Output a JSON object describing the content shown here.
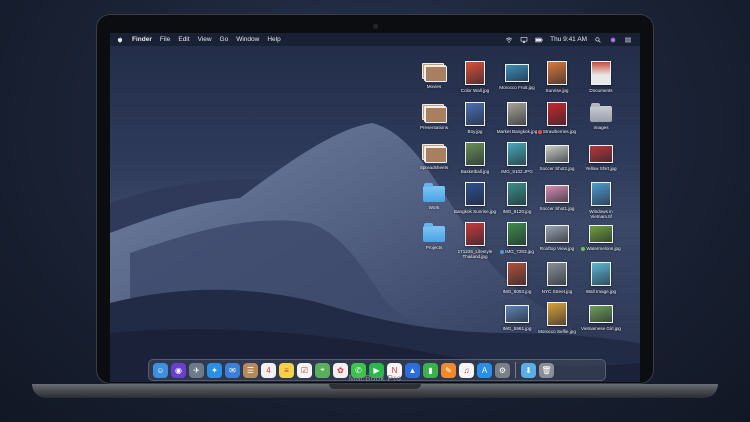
{
  "device": {
    "label": "MacBook Pro"
  },
  "menubar": {
    "items": [
      "Finder",
      "File",
      "Edit",
      "View",
      "Go",
      "Window",
      "Help"
    ],
    "clock": "Thu 9:41 AM",
    "icons": [
      "apple-icon",
      "wifi-icon",
      "airplay-icon",
      "battery-icon",
      "spotlight-icon",
      "siri-icon",
      "control-center-icon"
    ]
  },
  "desktop": {
    "items": [
      {
        "label": "Movies",
        "kind": "stack"
      },
      {
        "label": "Color Wall.jpg",
        "kind": "photo",
        "color": "#d9503a"
      },
      {
        "label": "Morocco Fruit.jpg",
        "kind": "photo-wide",
        "color": "#3b8fbf"
      },
      {
        "label": "Sunrise.jpg",
        "kind": "photo",
        "color": "#d97a3a"
      },
      {
        "label": "Documents",
        "kind": "doc"
      },
      {
        "label": "Presentations",
        "kind": "stack"
      },
      {
        "label": "Boy.jpg",
        "kind": "photo",
        "color": "#4b6fb5"
      },
      {
        "label": "Market Bangkok.jpg",
        "kind": "photo",
        "color": "#a8a39a"
      },
      {
        "label": "Strawberries.jpg",
        "kind": "photo",
        "color": "#c9282d",
        "tag": "#e84c3d"
      },
      {
        "label": "Images",
        "kind": "folder-gray"
      },
      {
        "label": "Spreadsheets",
        "kind": "stack"
      },
      {
        "label": "Basketball.jpg",
        "kind": "photo",
        "color": "#6a8f57"
      },
      {
        "label": "IMG_9102.JPG",
        "kind": "photo",
        "color": "#48a8b8"
      },
      {
        "label": "Soccer Shot2.jpg",
        "kind": "photo-wide",
        "color": "#c8cdc3"
      },
      {
        "label": "Yellow Shirt.jpg",
        "kind": "photo-wide",
        "color": "#b8363a"
      },
      {
        "label": "Work",
        "kind": "folder"
      },
      {
        "label": "Bangkok Sunrise.jpg",
        "kind": "photo",
        "color": "#2e4f8f"
      },
      {
        "label": "IMG_8120.jpg",
        "kind": "photo",
        "color": "#3a8f88"
      },
      {
        "label": "Soccer Shot1.jpg",
        "kind": "photo-wide",
        "color": "#d58fb0"
      },
      {
        "label": "Windows in Vietnam.tif",
        "kind": "photo",
        "color": "#4f9bd1"
      },
      {
        "label": "Projects",
        "kind": "folder"
      },
      {
        "label": "171225_Lifestyle Thailand.jpg",
        "kind": "photo",
        "color": "#c43a3a"
      },
      {
        "label": "IMG_7283.jpg",
        "kind": "photo",
        "color": "#3f8c4a",
        "tag": "#4a9be6"
      },
      {
        "label": "Rooftop View.jpg",
        "kind": "photo-wide",
        "color": "#9aa3ad"
      },
      {
        "label": "Watermelons.jpg",
        "kind": "photo-wide",
        "color": "#6fa03c",
        "tag": "#62c34a"
      },
      {
        "label": "IMG_6093.jpg",
        "kind": "photo",
        "color": "#b0503a"
      },
      {
        "label": "NYC Street.jpg",
        "kind": "photo",
        "color": "#8a8f95"
      },
      {
        "label": "Wall Image.jpg",
        "kind": "photo",
        "color": "#5db6d6"
      },
      {
        "label": "IMG_5961.jpg",
        "kind": "photo-wide",
        "color": "#5d83b6"
      },
      {
        "label": "Morocco Selfie.jpg",
        "kind": "photo",
        "color": "#d9a23a"
      },
      {
        "label": "Vietnamese Girl.jpg",
        "kind": "photo-wide",
        "color": "#6f9f5a"
      }
    ]
  },
  "dock": {
    "icons": [
      {
        "name": "finder-icon",
        "color": "#3d8fe0",
        "glyph": "☺"
      },
      {
        "name": "siri-icon",
        "color": "#6a3fd0",
        "glyph": "◉"
      },
      {
        "name": "launchpad-icon",
        "color": "#6c7a8a",
        "glyph": "✈"
      },
      {
        "name": "safari-icon",
        "color": "#2b8fe6",
        "glyph": "✦"
      },
      {
        "name": "mail-icon",
        "color": "#3a7fd8",
        "glyph": "✉"
      },
      {
        "name": "contacts-icon",
        "color": "#b48a5a",
        "glyph": "☰"
      },
      {
        "name": "calendar-icon",
        "color": "#f2f2f2",
        "glyph": "4"
      },
      {
        "name": "notes-icon",
        "color": "#f3d24a",
        "glyph": "≡"
      },
      {
        "name": "reminders-icon",
        "color": "#f5f5f5",
        "glyph": "☑"
      },
      {
        "name": "maps-icon",
        "color": "#5ab05a",
        "glyph": "⌖"
      },
      {
        "name": "photos-icon",
        "color": "#f0f0f0",
        "glyph": "✿"
      },
      {
        "name": "messages-icon",
        "color": "#3ac44a",
        "glyph": "✆"
      },
      {
        "name": "facetime-icon",
        "color": "#2ab84a",
        "glyph": "▶"
      },
      {
        "name": "news-icon",
        "color": "#f5f5f5",
        "glyph": "N"
      },
      {
        "name": "keynote-icon",
        "color": "#2a6ee0",
        "glyph": "▲"
      },
      {
        "name": "numbers-icon",
        "color": "#38b24a",
        "glyph": "▮"
      },
      {
        "name": "pages-icon",
        "color": "#f08a2a",
        "glyph": "✎"
      },
      {
        "name": "music-icon",
        "color": "#f5f5f5",
        "glyph": "♫"
      },
      {
        "name": "app-store-icon",
        "color": "#2a8fe8",
        "glyph": "A"
      },
      {
        "name": "system-preferences-icon",
        "color": "#7a7f88",
        "glyph": "⚙"
      },
      {
        "name": "downloads-folder-icon",
        "color": "#5aaee8",
        "glyph": "⬇"
      },
      {
        "name": "trash-icon",
        "color": "#8a8e96",
        "glyph": "🗑"
      }
    ]
  }
}
